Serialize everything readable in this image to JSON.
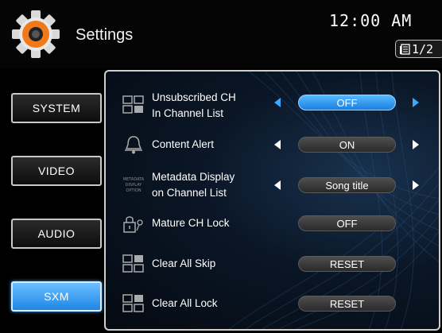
{
  "header": {
    "title": "Settings",
    "time": "12:00 AM",
    "page_indicator": "1/2"
  },
  "sidebar": {
    "items": [
      {
        "label": "SYSTEM",
        "active": false
      },
      {
        "label": "VIDEO",
        "active": false
      },
      {
        "label": "AUDIO",
        "active": false
      },
      {
        "label": "SXM",
        "active": true
      }
    ]
  },
  "settings": [
    {
      "label_line1": "Unsubscribed CH",
      "label_line2": "In Channel List",
      "value": "OFF",
      "has_arrows": true,
      "selected": true,
      "icon": "channel-grid-icon"
    },
    {
      "label_line1": "Content Alert",
      "label_line2": "",
      "value": "ON",
      "has_arrows": true,
      "selected": false,
      "icon": "bell-icon"
    },
    {
      "label_line1": "Metadata Display",
      "label_line2": "on Channel List",
      "value": "Song title",
      "has_arrows": true,
      "selected": false,
      "icon": "metadata-display-option-icon",
      "icon_text": "METADATA DISPLAY OPTION"
    },
    {
      "label_line1": "Mature CH Lock",
      "label_line2": "",
      "value": "OFF",
      "has_arrows": false,
      "selected": false,
      "icon": "lock-key-icon"
    },
    {
      "label_line1": "Clear All Skip",
      "label_line2": "",
      "value": "RESET",
      "has_arrows": false,
      "selected": false,
      "icon": "channel-grid-icon"
    },
    {
      "label_line1": "Clear All Lock",
      "label_line2": "",
      "value": "RESET",
      "has_arrows": false,
      "selected": false,
      "icon": "channel-grid-icon"
    }
  ],
  "colors": {
    "accent": "#2a93f0",
    "background": "#000000",
    "panel": "#0a1626"
  }
}
